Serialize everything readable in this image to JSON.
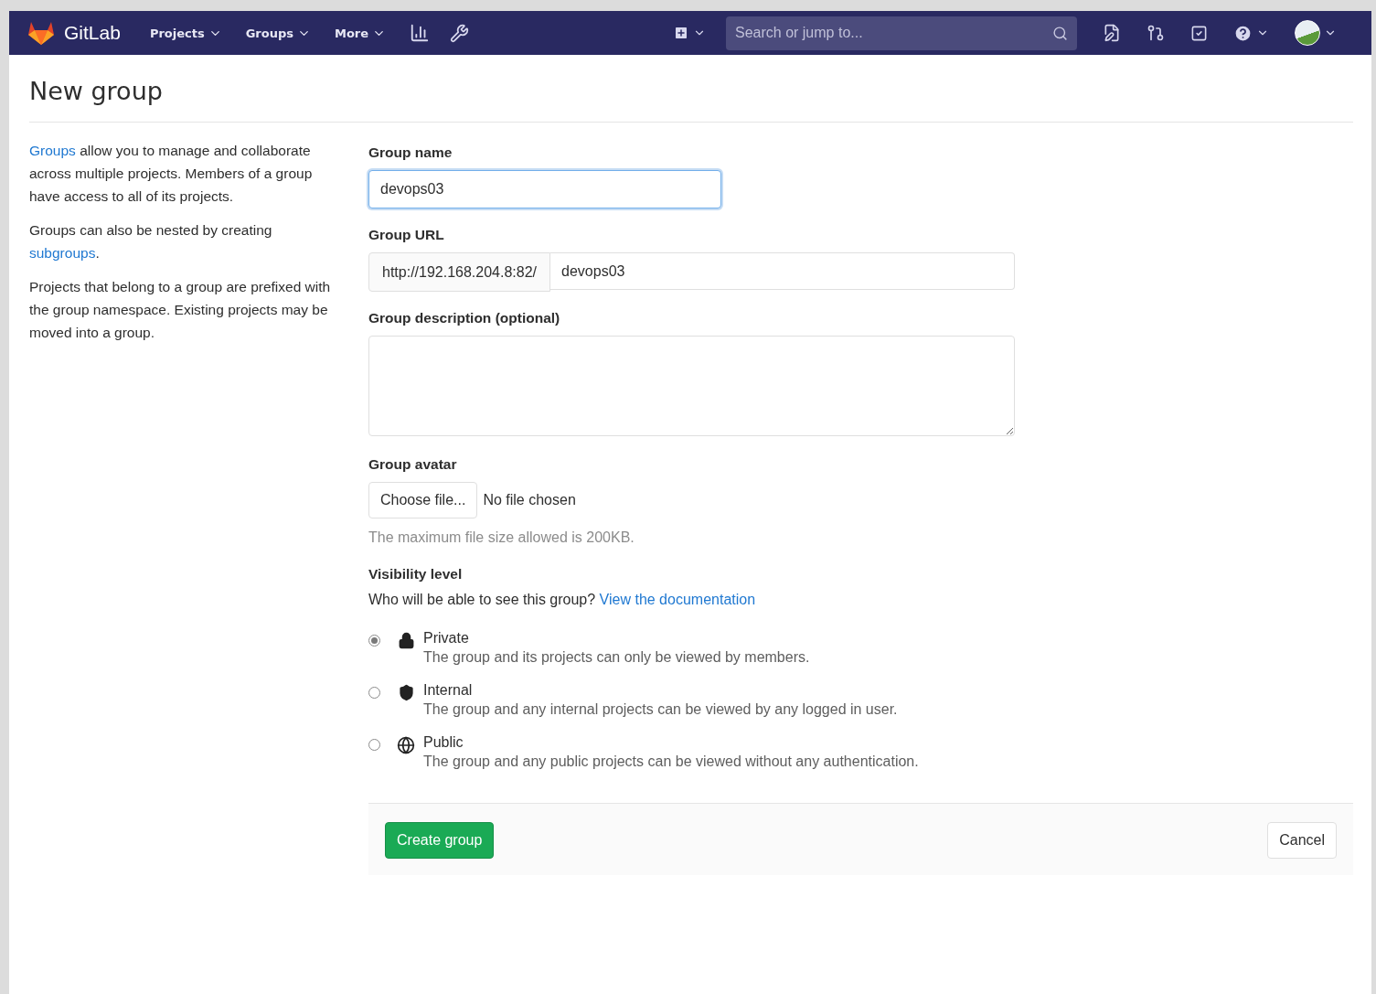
{
  "navbar": {
    "brand": "GitLab",
    "menus": [
      {
        "label": "Projects"
      },
      {
        "label": "Groups"
      },
      {
        "label": "More"
      }
    ],
    "search": {
      "placeholder": "Search or jump to..."
    }
  },
  "page": {
    "title": "New group"
  },
  "sidebar": {
    "paragraphs": [
      [
        {
          "kind": "link",
          "text": "Groups"
        },
        {
          "kind": "text",
          "text": " allow you to manage and collaborate across multiple projects. Members of a group have access to all of its projects."
        }
      ],
      [
        {
          "kind": "text",
          "text": "Groups can also be nested by creating "
        },
        {
          "kind": "link",
          "text": "subgroups"
        },
        {
          "kind": "text",
          "text": "."
        }
      ],
      [
        {
          "kind": "text",
          "text": "Projects that belong to a group are prefixed with the group namespace. Existing projects may be moved into a group."
        }
      ]
    ]
  },
  "form": {
    "group_name": {
      "label": "Group name",
      "value": "devops03",
      "focused": true
    },
    "group_url": {
      "label": "Group URL",
      "prefix": "http://192.168.204.8:82/",
      "value": "devops03"
    },
    "description": {
      "label": "Group description (optional)"
    },
    "avatar": {
      "label": "Group avatar",
      "button": "Choose file...",
      "status": "No file chosen",
      "hint": "The maximum file size allowed is 200KB."
    },
    "visibility": {
      "label": "Visibility level",
      "prompt": "Who will be able to see this group?",
      "link": "View the documentation",
      "options": [
        {
          "kind": "private",
          "label": "Private",
          "description": "The group and its projects can only be viewed by members.",
          "selected": true
        },
        {
          "kind": "internal",
          "label": "Internal",
          "description": "The group and any internal projects can be viewed by any logged in user.",
          "selected": false
        },
        {
          "kind": "public",
          "label": "Public",
          "description": "The group and any public projects can be viewed without any authentication.",
          "selected": false
        }
      ]
    },
    "actions": {
      "submit": "Create group",
      "cancel": "Cancel"
    }
  }
}
